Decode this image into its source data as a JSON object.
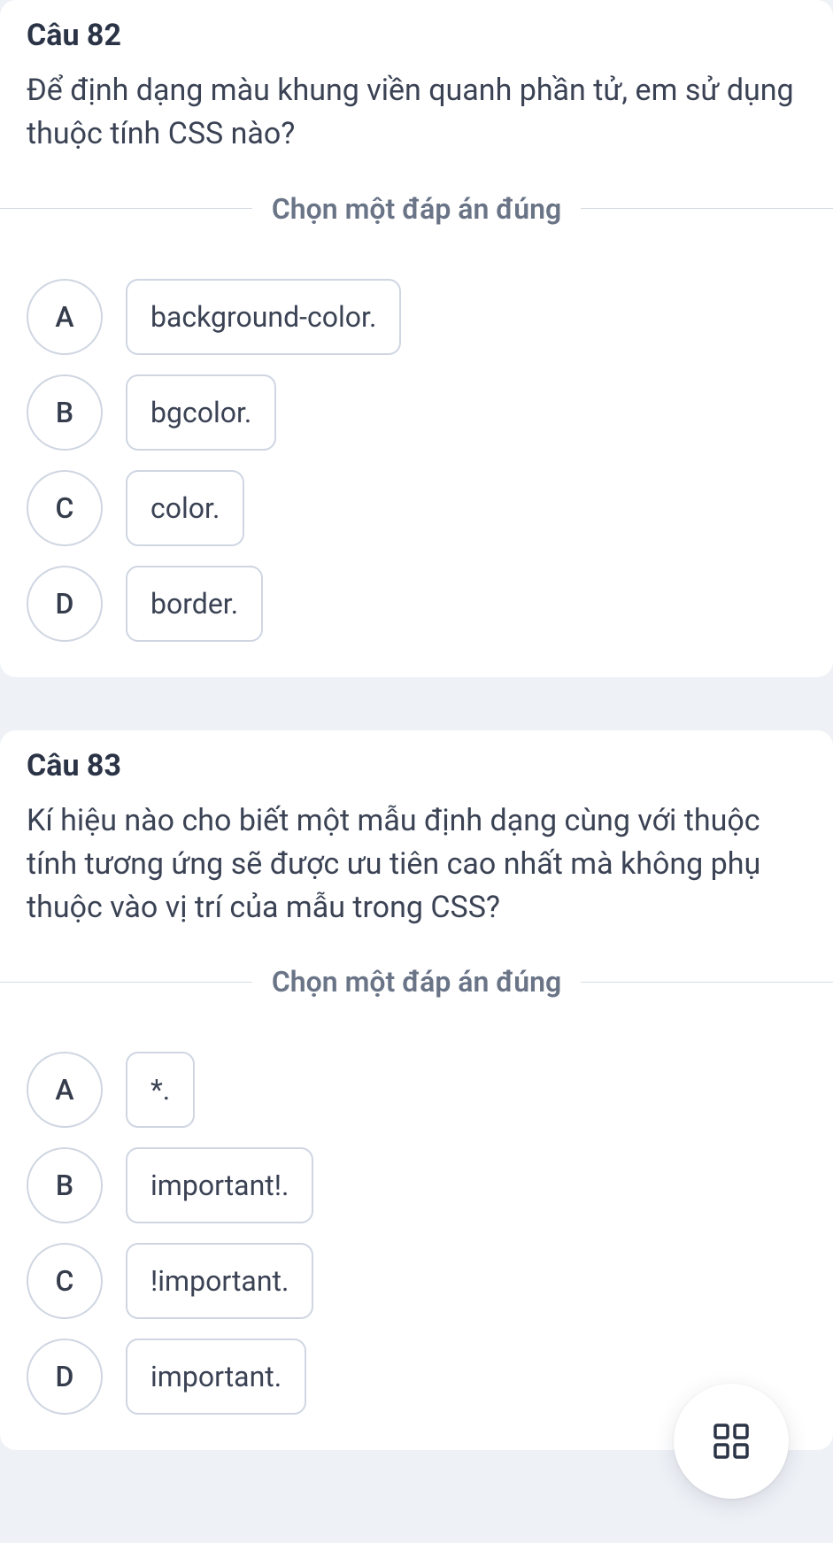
{
  "instruction": "Chọn một đáp án đúng",
  "questions": [
    {
      "number": "Câu 82",
      "text": "Để định dạng màu khung viền quanh phần tử, em sử dụng thuộc tính CSS nào?",
      "options": [
        {
          "letter": "A",
          "label": "background-color."
        },
        {
          "letter": "B",
          "label": "bgcolor."
        },
        {
          "letter": "C",
          "label": "color."
        },
        {
          "letter": "D",
          "label": "border."
        }
      ]
    },
    {
      "number": "Câu 83",
      "text": "Kí hiệu nào cho biết một mẫu định dạng cùng với thuộc tính tương ứng sẽ được ưu tiên cao nhất mà không phụ thuộc vào vị trí của mẫu trong CSS?",
      "options": [
        {
          "letter": "A",
          "label": "*."
        },
        {
          "letter": "B",
          "label": "important!."
        },
        {
          "letter": "C",
          "label": "!important."
        },
        {
          "letter": "D",
          "label": "important."
        }
      ]
    }
  ],
  "fab_icon_name": "grid-icon"
}
